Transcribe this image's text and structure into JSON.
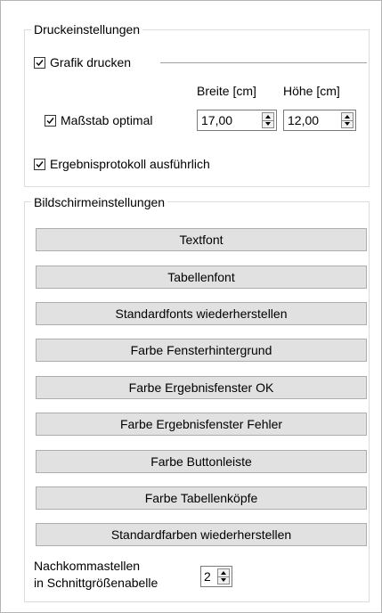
{
  "print": {
    "group_title": "Druckeinstellungen",
    "print_graphic": {
      "label": "Grafik drucken",
      "checked": true
    },
    "width_header": "Breite [cm]",
    "height_header": "Höhe [cm]",
    "optimal_scale": {
      "label": "Maßstab optimal",
      "checked": true
    },
    "width_value": "17,00",
    "height_value": "12,00",
    "detailed_log": {
      "label": "Ergebnisprotokoll ausführlich",
      "checked": true
    }
  },
  "screen": {
    "group_title": "Bildschirmeinstellungen",
    "buttons": [
      "Textfont",
      "Tabellenfont",
      "Standardfonts wiederherstellen",
      "Farbe Fensterhintergrund",
      "Farbe Ergebnisfenster OK",
      "Farbe Ergebnisfenster Fehler",
      "Farbe Buttonleiste",
      "Farbe Tabellenköpfe",
      "Standardfarben wiederherstellen"
    ],
    "decimals_label_line1": "Nachkommastellen",
    "decimals_label_line2": "in Schnittgrößenabelle",
    "decimals_value": "2"
  }
}
